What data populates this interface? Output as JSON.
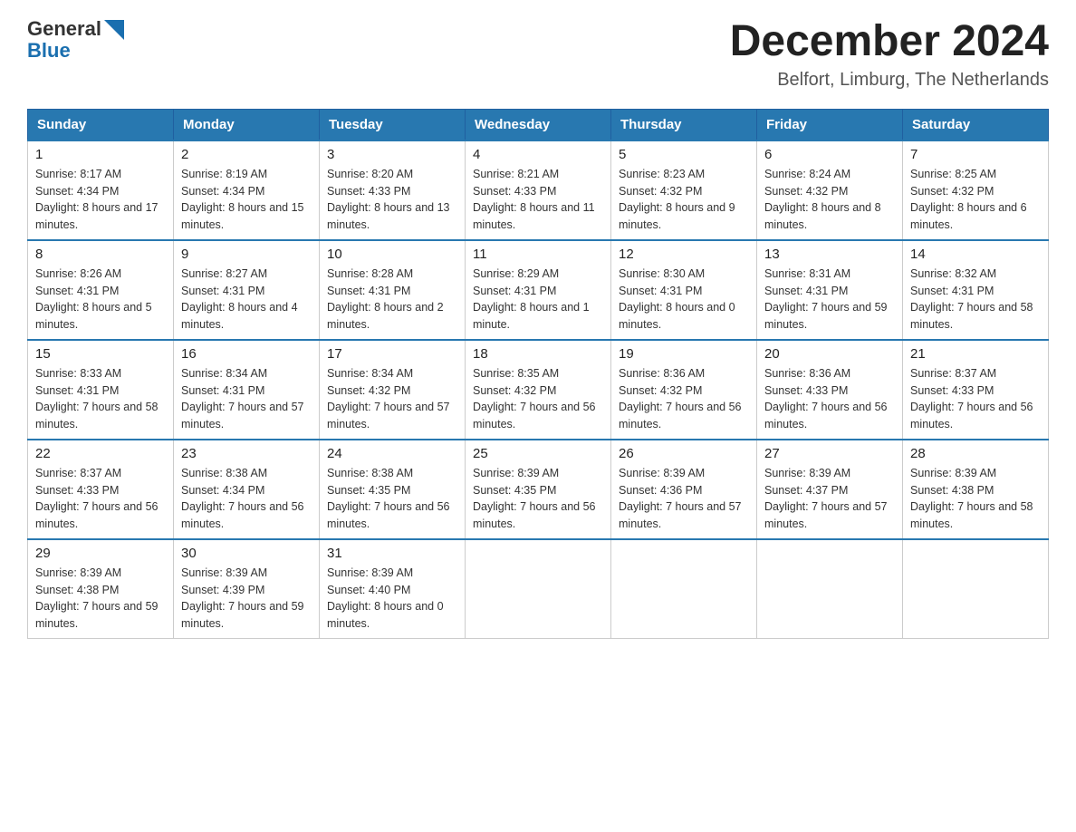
{
  "logo": {
    "text_general": "General",
    "text_blue": "Blue",
    "aria": "GeneralBlue logo"
  },
  "title": "December 2024",
  "subtitle": "Belfort, Limburg, The Netherlands",
  "headers": [
    "Sunday",
    "Monday",
    "Tuesday",
    "Wednesday",
    "Thursday",
    "Friday",
    "Saturday"
  ],
  "weeks": [
    [
      {
        "day": "1",
        "sunrise": "8:17 AM",
        "sunset": "4:34 PM",
        "daylight": "8 hours and 17 minutes."
      },
      {
        "day": "2",
        "sunrise": "8:19 AM",
        "sunset": "4:34 PM",
        "daylight": "8 hours and 15 minutes."
      },
      {
        "day": "3",
        "sunrise": "8:20 AM",
        "sunset": "4:33 PM",
        "daylight": "8 hours and 13 minutes."
      },
      {
        "day": "4",
        "sunrise": "8:21 AM",
        "sunset": "4:33 PM",
        "daylight": "8 hours and 11 minutes."
      },
      {
        "day": "5",
        "sunrise": "8:23 AM",
        "sunset": "4:32 PM",
        "daylight": "8 hours and 9 minutes."
      },
      {
        "day": "6",
        "sunrise": "8:24 AM",
        "sunset": "4:32 PM",
        "daylight": "8 hours and 8 minutes."
      },
      {
        "day": "7",
        "sunrise": "8:25 AM",
        "sunset": "4:32 PM",
        "daylight": "8 hours and 6 minutes."
      }
    ],
    [
      {
        "day": "8",
        "sunrise": "8:26 AM",
        "sunset": "4:31 PM",
        "daylight": "8 hours and 5 minutes."
      },
      {
        "day": "9",
        "sunrise": "8:27 AM",
        "sunset": "4:31 PM",
        "daylight": "8 hours and 4 minutes."
      },
      {
        "day": "10",
        "sunrise": "8:28 AM",
        "sunset": "4:31 PM",
        "daylight": "8 hours and 2 minutes."
      },
      {
        "day": "11",
        "sunrise": "8:29 AM",
        "sunset": "4:31 PM",
        "daylight": "8 hours and 1 minute."
      },
      {
        "day": "12",
        "sunrise": "8:30 AM",
        "sunset": "4:31 PM",
        "daylight": "8 hours and 0 minutes."
      },
      {
        "day": "13",
        "sunrise": "8:31 AM",
        "sunset": "4:31 PM",
        "daylight": "7 hours and 59 minutes."
      },
      {
        "day": "14",
        "sunrise": "8:32 AM",
        "sunset": "4:31 PM",
        "daylight": "7 hours and 58 minutes."
      }
    ],
    [
      {
        "day": "15",
        "sunrise": "8:33 AM",
        "sunset": "4:31 PM",
        "daylight": "7 hours and 58 minutes."
      },
      {
        "day": "16",
        "sunrise": "8:34 AM",
        "sunset": "4:31 PM",
        "daylight": "7 hours and 57 minutes."
      },
      {
        "day": "17",
        "sunrise": "8:34 AM",
        "sunset": "4:32 PM",
        "daylight": "7 hours and 57 minutes."
      },
      {
        "day": "18",
        "sunrise": "8:35 AM",
        "sunset": "4:32 PM",
        "daylight": "7 hours and 56 minutes."
      },
      {
        "day": "19",
        "sunrise": "8:36 AM",
        "sunset": "4:32 PM",
        "daylight": "7 hours and 56 minutes."
      },
      {
        "day": "20",
        "sunrise": "8:36 AM",
        "sunset": "4:33 PM",
        "daylight": "7 hours and 56 minutes."
      },
      {
        "day": "21",
        "sunrise": "8:37 AM",
        "sunset": "4:33 PM",
        "daylight": "7 hours and 56 minutes."
      }
    ],
    [
      {
        "day": "22",
        "sunrise": "8:37 AM",
        "sunset": "4:33 PM",
        "daylight": "7 hours and 56 minutes."
      },
      {
        "day": "23",
        "sunrise": "8:38 AM",
        "sunset": "4:34 PM",
        "daylight": "7 hours and 56 minutes."
      },
      {
        "day": "24",
        "sunrise": "8:38 AM",
        "sunset": "4:35 PM",
        "daylight": "7 hours and 56 minutes."
      },
      {
        "day": "25",
        "sunrise": "8:39 AM",
        "sunset": "4:35 PM",
        "daylight": "7 hours and 56 minutes."
      },
      {
        "day": "26",
        "sunrise": "8:39 AM",
        "sunset": "4:36 PM",
        "daylight": "7 hours and 57 minutes."
      },
      {
        "day": "27",
        "sunrise": "8:39 AM",
        "sunset": "4:37 PM",
        "daylight": "7 hours and 57 minutes."
      },
      {
        "day": "28",
        "sunrise": "8:39 AM",
        "sunset": "4:38 PM",
        "daylight": "7 hours and 58 minutes."
      }
    ],
    [
      {
        "day": "29",
        "sunrise": "8:39 AM",
        "sunset": "4:38 PM",
        "daylight": "7 hours and 59 minutes."
      },
      {
        "day": "30",
        "sunrise": "8:39 AM",
        "sunset": "4:39 PM",
        "daylight": "7 hours and 59 minutes."
      },
      {
        "day": "31",
        "sunrise": "8:39 AM",
        "sunset": "4:40 PM",
        "daylight": "8 hours and 0 minutes."
      },
      null,
      null,
      null,
      null
    ]
  ]
}
